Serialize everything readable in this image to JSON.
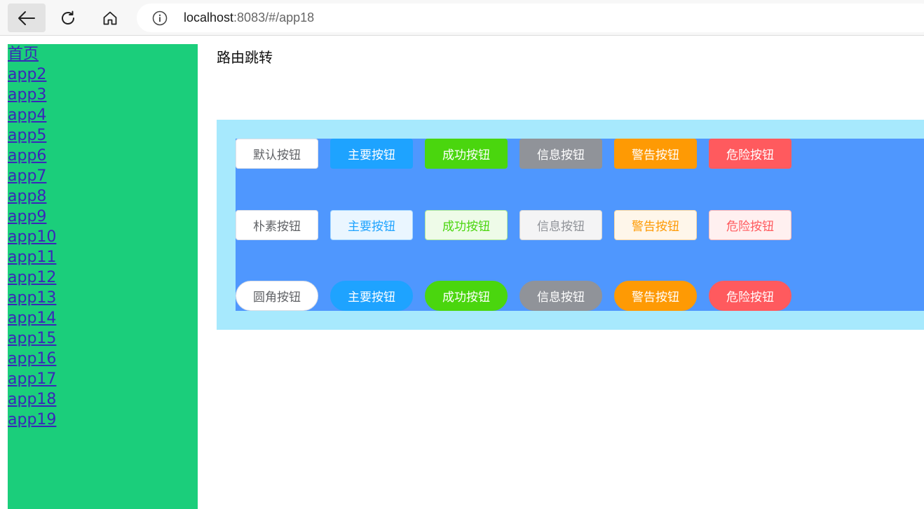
{
  "browser": {
    "url_host": "localhost",
    "url_rest": ":8083/#/app18",
    "icons": {
      "back": "back-arrow-icon",
      "reload": "reload-icon",
      "home": "home-icon",
      "info": "info-icon"
    }
  },
  "sidebar": {
    "links": [
      "首页",
      "app2",
      "app3",
      "app4",
      "app5",
      "app6",
      "app7",
      "app8",
      "app9",
      "app10",
      "app11",
      "app12",
      "app13",
      "app14",
      "app15",
      "app16",
      "app17",
      "app18",
      "app19"
    ]
  },
  "main": {
    "title": "路由跳转",
    "rows": [
      {
        "style": "solid",
        "buttons": [
          "默认按钮",
          "主要按钮",
          "成功按钮",
          "信息按钮",
          "警告按钮",
          "危险按钮"
        ]
      },
      {
        "style": "plain",
        "buttons": [
          "朴素按钮",
          "主要按钮",
          "成功按钮",
          "信息按钮",
          "警告按钮",
          "危险按钮"
        ]
      },
      {
        "style": "round",
        "buttons": [
          "圆角按钮",
          "主要按钮",
          "成功按钮",
          "信息按钮",
          "警告按钮",
          "危险按钮"
        ]
      }
    ]
  },
  "colors": {
    "sidebar": "#1bce7b",
    "link": "#3a27b8",
    "outer_panel": "#a7e9fd",
    "inner_panel": "#4f97fe",
    "primary": "#1ea3ff",
    "success": "#4ad60e",
    "info": "#909399",
    "warning": "#fe9a04",
    "danger": "#ff5a5e"
  }
}
